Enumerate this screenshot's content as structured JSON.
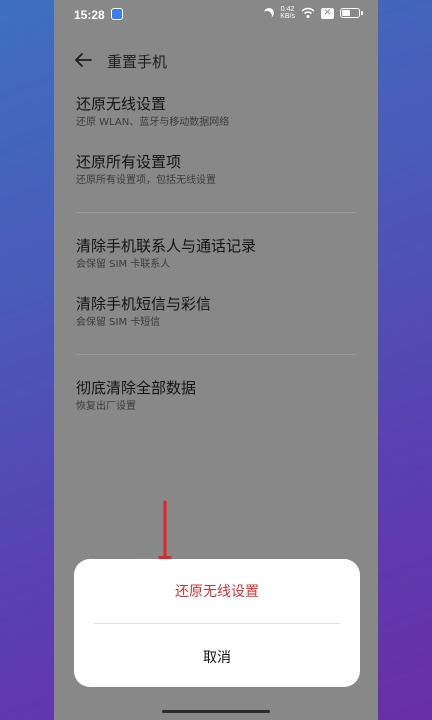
{
  "status_bar": {
    "time": "15:28",
    "net_speed_value": "0.42",
    "net_speed_unit": "KB/s",
    "icons": [
      "app-notification-icon",
      "moon-icon",
      "wifi-icon",
      "x-icon",
      "battery-icon"
    ]
  },
  "header": {
    "back_icon": "arrow-left-icon",
    "title": "重置手机"
  },
  "settings": {
    "items": [
      {
        "title": "还原无线设置",
        "subtitle": "还原 WLAN、蓝牙与移动数据网络"
      },
      {
        "title": "还原所有设置项",
        "subtitle": "还原所有设置项，包括无线设置"
      },
      {
        "title": "清除手机联系人与通话记录",
        "subtitle": "会保留 SIM 卡联系人"
      },
      {
        "title": "清除手机短信与彩信",
        "subtitle": "会保留 SIM 卡短信"
      },
      {
        "title": "彻底清除全部数据",
        "subtitle": "恢复出厂设置"
      }
    ]
  },
  "dialog": {
    "primary_label": "还原无线设置",
    "cancel_label": "取消"
  },
  "colors": {
    "overlay_gray": "#888888",
    "danger_text": "#d0343a",
    "arrow_red": "#e0262a",
    "background_blue": "#3f6fc0",
    "background_purple": "#6a2ea8"
  }
}
